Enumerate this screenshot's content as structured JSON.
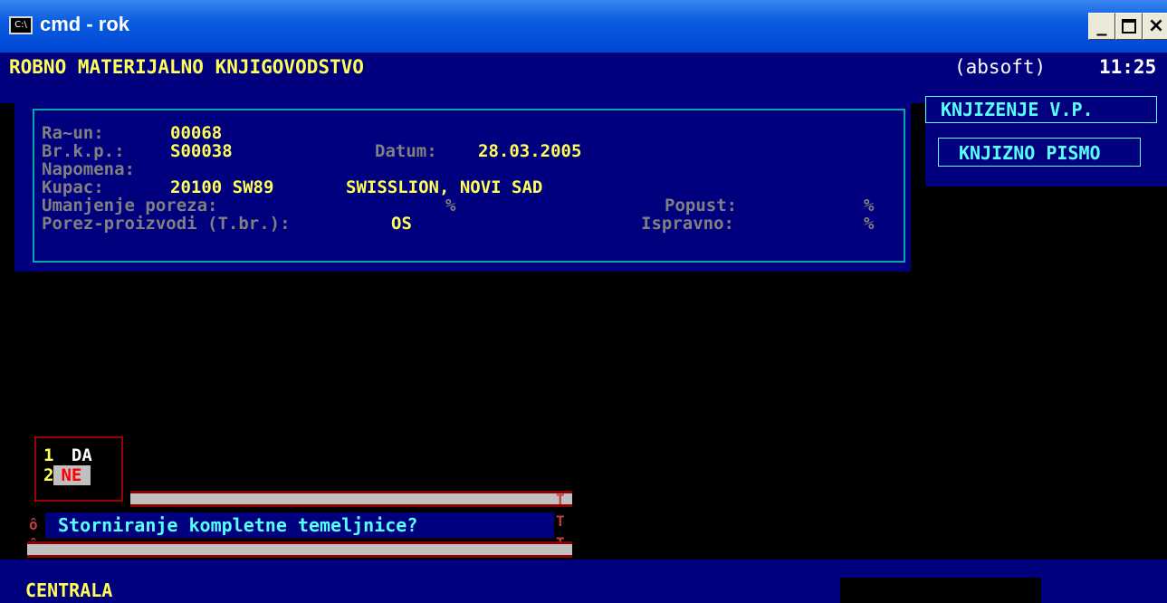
{
  "window": {
    "icon_text": "C:\\",
    "title": "cmd - rok",
    "buttons": {
      "minimize": "_",
      "close": "×"
    }
  },
  "header": {
    "app_name": "ROBNO MATERIJALNO KNJIGOVODSTVO",
    "vendor": "(absoft)",
    "time": "11:25"
  },
  "side_menu": {
    "items": [
      "KNJIZENJE V.P.",
      "KNJIZNO PISMO"
    ]
  },
  "form": {
    "racun_label": "Ra~un:",
    "racun_value": "00068",
    "brkp_label": "Br.k.p.:",
    "brkp_value": "S00038",
    "datum_label": "Datum:",
    "datum_value": "28.03.2005",
    "napomena_label": "Napomena:",
    "kupac_label": "Kupac:",
    "kupac_code": "20100 SW89",
    "kupac_name": "SWISSLION, NOVI SAD",
    "umanjenje_label": "Umanjenje poreza:",
    "umanjenje_pct": "%",
    "popust_label": "Popust:",
    "popust_pct": "%",
    "porez_label": "Porez-proizvodi (T.br.):",
    "porez_value": "OS",
    "ispravno_label": "Ispravno:",
    "ispravno_pct": "%"
  },
  "dialog": {
    "options": [
      {
        "num": "1",
        "label": "DA"
      },
      {
        "num": "2",
        "label": "NE"
      }
    ],
    "selected": "NE",
    "question": "Storniranje kompletne temeljnice?"
  },
  "status": {
    "location": "CENTRALA"
  },
  "colors": {
    "console_bg": "#000000",
    "panel_blue": "#00007e",
    "yellow": "#ffff55",
    "cyan": "#55ffff",
    "border_cyan": "#00aaaa",
    "xp_title_blue": "#0047d6"
  }
}
